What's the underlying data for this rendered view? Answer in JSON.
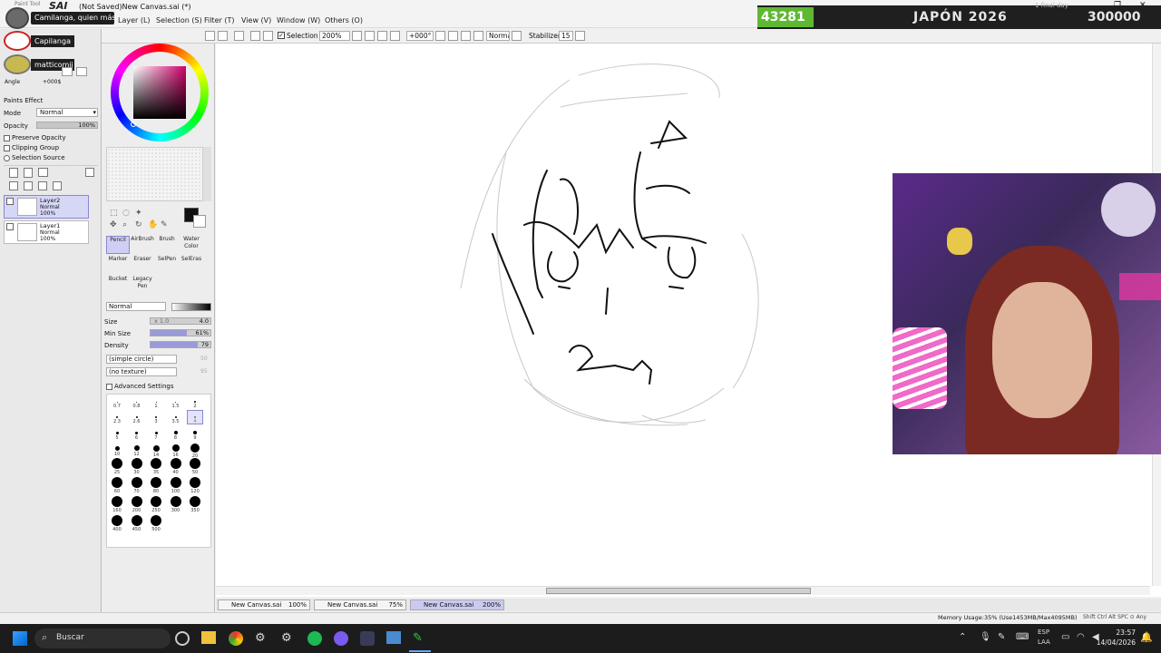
{
  "window": {
    "app_logo": "SAI",
    "title": "(Not Saved)New Canvas.sai (*)"
  },
  "menu": [
    "Layer (L)",
    "Selection (S)",
    "Filter (T)",
    "View (V)",
    "Window (W)",
    "Others (O)"
  ],
  "chat": {
    "message": "Camilanga, quien más",
    "users": [
      "Capilanga",
      "matticomii"
    ]
  },
  "counter_overlay": {
    "count": "43281",
    "title": "JAPÓN 2026",
    "goal": "300000",
    "subtitle": "1 final day"
  },
  "toolbar": {
    "selection_label": "Selection",
    "zoom": "200%",
    "rotation": "+000°",
    "blend_mode": "Normal",
    "stabilizer_label": "Stabilizer",
    "stabilizer_value": "15"
  },
  "navigator": {
    "angle_label": "Angle",
    "angle_value": "+000$"
  },
  "layer_panel": {
    "paints_effect": "Paints Effect",
    "mode_label": "Mode",
    "mode_value": "Normal",
    "opacity_label": "Opacity",
    "opacity_value": "100%",
    "preserve_opacity": "Preserve Opacity",
    "clipping_group": "Clipping Group",
    "selection_source": "Selection Source",
    "layers": [
      {
        "name": "Layer2",
        "mode": "Normal",
        "opacity": "100%",
        "selected": true
      },
      {
        "name": "Layer1",
        "mode": "Normal",
        "opacity": "100%",
        "selected": false
      }
    ]
  },
  "tools": {
    "row1": [
      "Pencil",
      "AirBrush",
      "Brush",
      "Water Color"
    ],
    "row2": [
      "Marker",
      "Eraser",
      "SelPen",
      "SelEras"
    ],
    "row3": [
      "Bucket",
      "Legacy Pen"
    ],
    "active": "Pencil"
  },
  "brush_settings": {
    "blend": "Normal",
    "size_label": "Size",
    "size_mult": "x 1.0",
    "size_value": "4.0",
    "min_size_label": "Min Size",
    "min_size_value": "61%",
    "min_size_fraction": 0.61,
    "density_label": "Density",
    "density_value": "79",
    "density_fraction": 0.79,
    "shape": "(simple circle)",
    "shape_value": "50",
    "texture": "(no texture)",
    "texture_value": "95",
    "advanced": "Advanced Settings"
  },
  "brush_sizes": {
    "row1": [
      "0.7",
      "0.8",
      "1",
      "1.5",
      "2"
    ],
    "row2": [
      "2.3",
      "2.6",
      "3",
      "3.5",
      "4"
    ],
    "row3": [
      "5",
      "6",
      "7",
      "8",
      "9"
    ],
    "row4": [
      "10",
      "12",
      "14",
      "16",
      "20"
    ],
    "row5": [
      "25",
      "30",
      "35",
      "40",
      "50"
    ],
    "row6": [
      "60",
      "70",
      "80",
      "100",
      "120"
    ],
    "row7": [
      "160",
      "200",
      "250",
      "300",
      "350"
    ],
    "row8": [
      "400",
      "450",
      "500"
    ]
  },
  "tabs": [
    {
      "name": "New Canvas.sai",
      "zoom": "100%",
      "active": false
    },
    {
      "name": "New Canvas.sai",
      "zoom": "75%",
      "active": false
    },
    {
      "name": "New Canvas.sai",
      "zoom": "200%",
      "active": true
    }
  ],
  "status": {
    "memory": "Memory Usage:35% (Use1453MB/Max4095MB)",
    "keys": "Shift Ctrl Alt SPC ⊙ Any"
  },
  "taskbar": {
    "search_placeholder": "Buscar",
    "lang_top": "ESP",
    "lang_bottom": "LAA",
    "time": "23:57",
    "date": "14/04/2026"
  },
  "colors": {
    "accent_green": "#5fb832",
    "overlay_dark": "#1f1f1f",
    "layer_selected": "#d6d6f7",
    "taskbar": "#1c1c1c"
  }
}
